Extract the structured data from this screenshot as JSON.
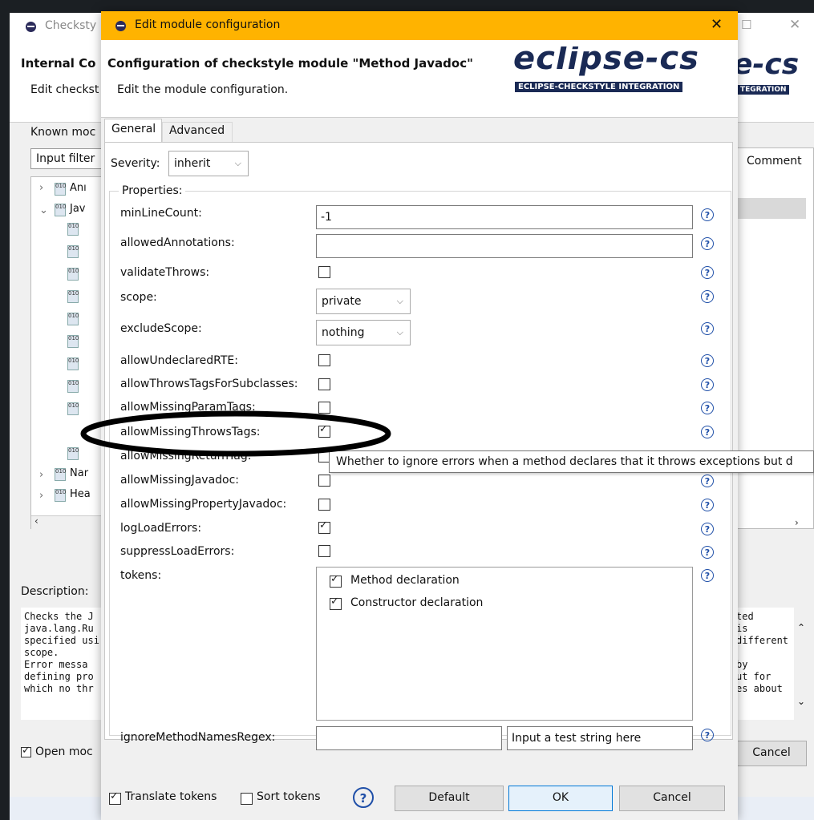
{
  "background_window": {
    "title": "Checksty",
    "header_title": "Internal Co",
    "header_subtitle": "Edit checkst",
    "known_modules_label": "Known moc",
    "input_filter": "Input filter",
    "tree_items": [
      "Anı",
      "Jav",
      "Nar",
      "Hea"
    ],
    "comment_column": "Comment",
    "description_label": "Description:",
    "description_left": "Checks the J\njava.lang.Ru\nspecified usi\nscope.\nError messa\ndefining pro\nwhich no thr",
    "description_right": "ted\nis\ndifferent\n\nby\nut for\nes about",
    "open_mod_label": "Open moc",
    "cancel_label": "Cancel",
    "banner_fragment": "e-cs",
    "banner_fragment_sub": "TEGRATION"
  },
  "dialog": {
    "title": "Edit module configuration",
    "header_title": "Configuration of checkstyle module \"Method Javadoc\"",
    "header_subtitle": "Edit the module configuration.",
    "banner_text": "eclipse-cs",
    "banner_sub": "ECLIPSE-CHECKSTYLE INTEGRATION",
    "tabs": [
      "General",
      "Advanced"
    ],
    "severity_label": "Severity:",
    "severity_value": "inherit",
    "properties_label": "Properties:",
    "properties": {
      "minLineCount": {
        "label": "minLineCount:",
        "value": "-1"
      },
      "allowedAnnotations": {
        "label": "allowedAnnotations:",
        "value": ""
      },
      "validateThrows": {
        "label": "validateThrows:",
        "checked": false
      },
      "scope": {
        "label": "scope:",
        "value": "private"
      },
      "excludeScope": {
        "label": "excludeScope:",
        "value": "nothing"
      },
      "allowUndeclaredRTE": {
        "label": "allowUndeclaredRTE:",
        "checked": false
      },
      "allowThrowsTagsForSubclasses": {
        "label": "allowThrowsTagsForSubclasses:",
        "checked": false
      },
      "allowMissingParamTags": {
        "label": "allowMissingParamTags:",
        "checked": false
      },
      "allowMissingThrowsTags": {
        "label": "allowMissingThrowsTags:",
        "checked": true
      },
      "allowMissingReturnTag": {
        "label": "allowMissingReturnTag:",
        "checked": false
      },
      "allowMissingJavadoc": {
        "label": "allowMissingJavadoc:",
        "checked": false
      },
      "allowMissingPropertyJavadoc": {
        "label": "allowMissingPropertyJavadoc:",
        "checked": false
      },
      "logLoadErrors": {
        "label": "logLoadErrors:",
        "checked": true
      },
      "suppressLoadErrors": {
        "label": "suppressLoadErrors:",
        "checked": false
      },
      "tokens": {
        "label": "tokens:",
        "items": [
          "Method declaration",
          "Constructor declaration"
        ]
      },
      "ignoreMethodNamesRegex": {
        "label": "ignoreMethodNamesRegex:",
        "value": "",
        "test_placeholder": "Input a test string here"
      }
    },
    "tooltip": "Whether to ignore errors when a method declares that it throws exceptions but d",
    "translate_tokens_label": "Translate tokens",
    "sort_tokens_label": "Sort tokens",
    "default_button": "Default",
    "ok_button": "OK",
    "cancel_button": "Cancel",
    "title_bar_color": "#ffb300"
  }
}
